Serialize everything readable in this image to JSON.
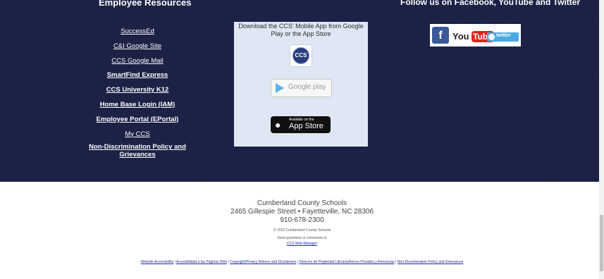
{
  "footer": {
    "employee": {
      "title": "Employee Resources",
      "links": [
        {
          "label": "SuccessEd",
          "bold": false
        },
        {
          "label": "C&I Google Site",
          "bold": false
        },
        {
          "label": "CCS Google Mail",
          "bold": false
        },
        {
          "label": "SmartFind Express",
          "bold": true
        },
        {
          "label": "CCS University K12",
          "bold": true
        },
        {
          "label": "Home Base Login (IAM)",
          "bold": true
        },
        {
          "label": "Employee Portal (EPortal)",
          "bold": true
        },
        {
          "label": "My CCS",
          "bold": false
        },
        {
          "label": "Non-Discrimination Policy and Grievances",
          "bold": true
        }
      ]
    },
    "app": {
      "text": "Download the CCS' Mobile App from Google Play or the App Store",
      "logo_text": "CCS",
      "google_play_label": "Google play",
      "app_store_small": "Available on the",
      "app_store_label": "App Store"
    },
    "social": {
      "title": "Follow us on Facebook, YouTube and Twitter",
      "facebook_glyph": "f",
      "youtube_you": "You",
      "youtube_tube": "Tube",
      "twitter_label": "twitter"
    },
    "address": {
      "org": "Cumberland County Schools",
      "street": "2465 Gillespie Street • Fayetteville, NC 28306",
      "phone": "910-678-2300"
    },
    "copyright": "© 2019 Cumberland County Schools",
    "send_text": "Send questions or comments to",
    "web_manager": "CCS Web Manager",
    "bottom_links": [
      "Website Accessibility",
      "Accesibilidad a las Páginas Web",
      "Copyright/Privacy Notices and Disclaimers",
      "Derecho de Propiedad Literaria/Avisos Privados y Renuncias",
      "Non-Discrimination Policy and Grievances"
    ]
  },
  "colors": {
    "footer_bg": "#1b2045",
    "app_box_bg": "#dfe7f5",
    "link_blue": "#1a2b9a"
  },
  "icons": [
    "ccs-logo-icon",
    "google-play-icon",
    "apple-icon",
    "facebook-icon",
    "youtube-icon",
    "twitter-icon"
  ]
}
